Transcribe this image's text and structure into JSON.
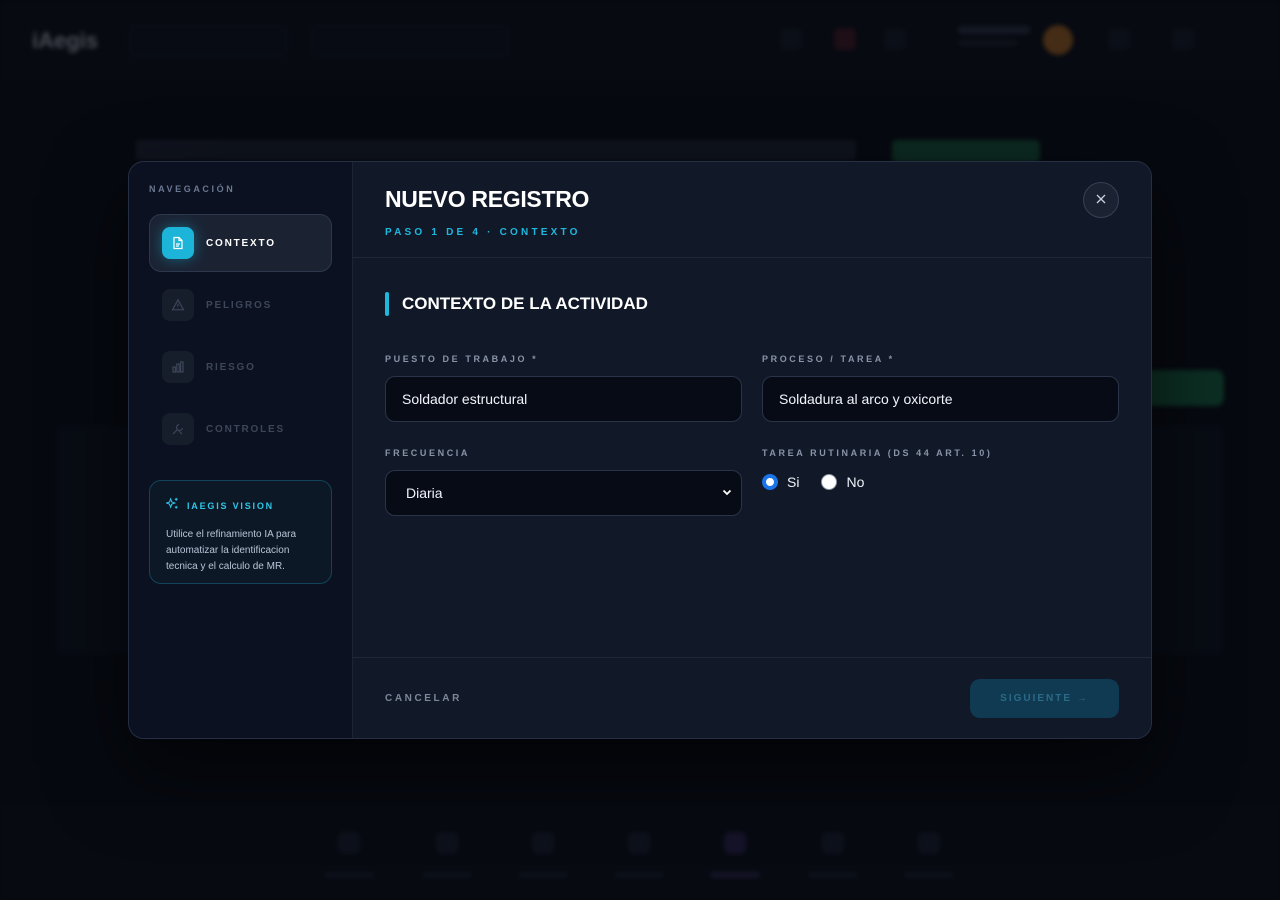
{
  "modal": {
    "title": "NUEVO REGISTRO",
    "step": "PASO 1 DE 4 · CONTEXTO",
    "close_icon": "close-icon"
  },
  "sidebar": {
    "heading": "NAVEGACIÓN",
    "items": [
      {
        "label": "CONTEXTO",
        "icon": "document-icon",
        "active": true
      },
      {
        "label": "PELIGROS",
        "icon": "warning-icon",
        "active": false
      },
      {
        "label": "RIESGO",
        "icon": "bar-chart-icon",
        "active": false
      },
      {
        "label": "CONTROLES",
        "icon": "tools-icon",
        "active": false
      }
    ],
    "vision": {
      "title": "IAEGIS VISION",
      "icon": "sparkles-icon",
      "text": "Utilice el refinamiento IA para automatizar la identificacion tecnica y el calculo de MR."
    }
  },
  "section": {
    "title": "CONTEXTO DE LA ACTIVIDAD"
  },
  "form": {
    "puesto": {
      "label": "PUESTO DE TRABAJO *",
      "value": "Soldador estructural"
    },
    "proceso": {
      "label": "PROCESO / TAREA *",
      "value": "Soldadura al arco y oxicorte"
    },
    "frecuencia": {
      "label": "FRECUENCIA",
      "value": "Diaria"
    },
    "rutinaria": {
      "label": "TAREA RUTINARIA (DS 44 ART. 10)",
      "options": [
        {
          "label": "Si",
          "checked": true
        },
        {
          "label": "No",
          "checked": false
        }
      ]
    }
  },
  "footer": {
    "cancel": "CANCELAR",
    "next": "SIGUIENTE →"
  },
  "colors": {
    "accent": "#1eb8df",
    "background": "#111827",
    "sidebar": "#0b1120"
  }
}
